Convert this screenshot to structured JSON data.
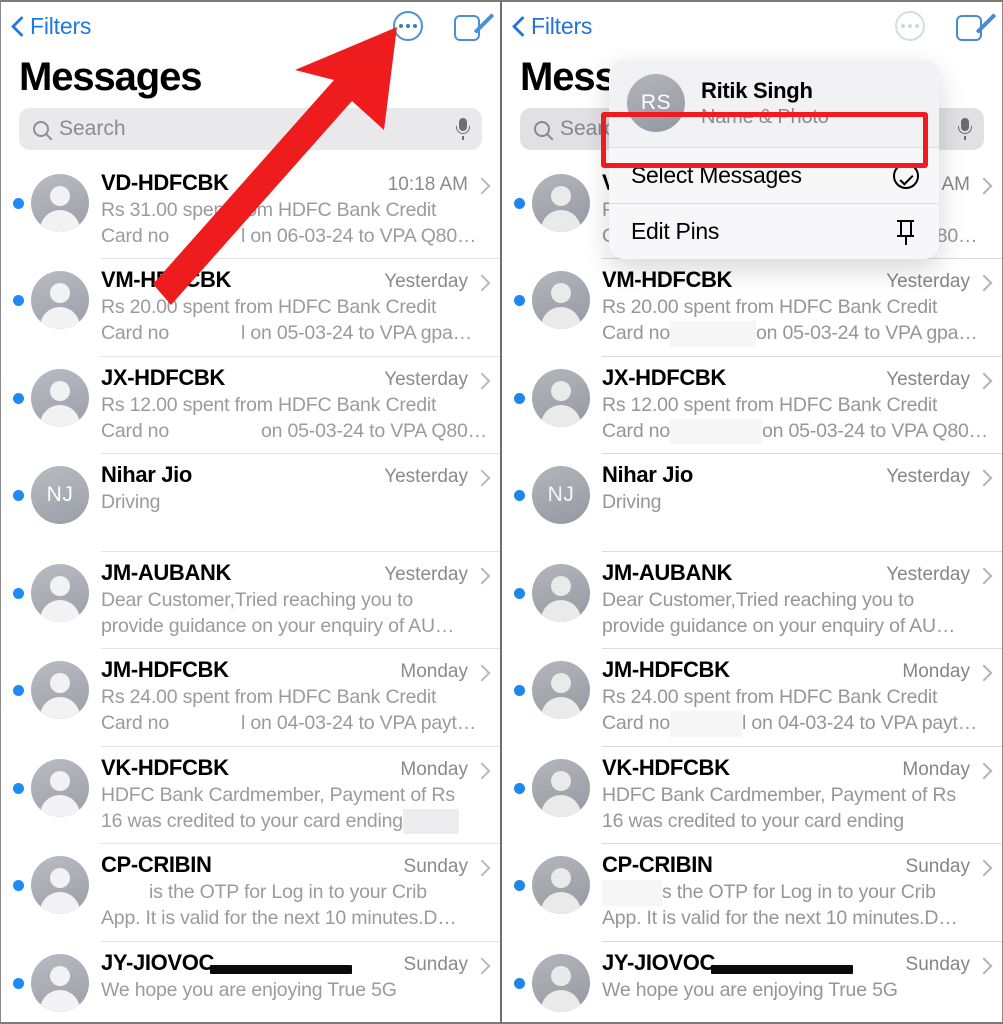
{
  "nav": {
    "back_label": "Filters",
    "more_icon": "ellipsis-circle-icon",
    "compose_icon": "compose-icon"
  },
  "header": {
    "title": "Messages"
  },
  "search": {
    "placeholder": "Search",
    "value": "",
    "mic_icon": "microphone-icon",
    "search_icon": "search-icon"
  },
  "popup": {
    "profile": {
      "initials": "RS",
      "name": "Ritik Singh",
      "subtitle": "Name & Photo"
    },
    "items": [
      {
        "label": "Select Messages",
        "icon": "check-circle-icon",
        "highlighted": true
      },
      {
        "label": "Edit Pins",
        "icon": "pin-icon",
        "highlighted": false
      }
    ]
  },
  "annotations": {
    "arrow_color": "#ee1c1c",
    "highlight_color": "#ef1b20"
  },
  "conversations": [
    {
      "title": "VD-HDFCBK",
      "time": "10:18 AM",
      "initials": "",
      "unread": true,
      "line1": "Rs 31.00 spent from HDFC Bank Credit",
      "line2_a": "Card no",
      "line2_b": "l on 06-03-24 to VPA Q80…"
    },
    {
      "title": "VM-HDFCBK",
      "time": "Yesterday",
      "initials": "",
      "unread": true,
      "line1": "Rs 20.00 spent from HDFC Bank Credit",
      "line2_a": "Card no",
      "line2_b": "l on 05-03-24 to VPA gpa…"
    },
    {
      "title": "JX-HDFCBK",
      "time": "Yesterday",
      "initials": "",
      "unread": true,
      "line1": "Rs 12.00 spent from HDFC Bank Credit",
      "line2_a": "Card no",
      "line2_b": "on 05-03-24 to VPA Q80…"
    },
    {
      "title": "Nihar Jio",
      "time": "Yesterday",
      "initials": "NJ",
      "unread": true,
      "line1": "Driving",
      "line2_a": "",
      "line2_b": ""
    },
    {
      "title": "JM-AUBANK",
      "time": "Yesterday",
      "initials": "",
      "unread": true,
      "line1": "Dear Customer,Tried reaching you to",
      "line2_a": "provide guidance on your enquiry of AU…",
      "line2_b": ""
    },
    {
      "title": "JM-HDFCBK",
      "time": "Monday",
      "initials": "",
      "unread": true,
      "line1": "Rs 24.00 spent from HDFC Bank Credit",
      "line2_a": "Card no",
      "line2_b": "l on 04-03-24 to VPA payt…"
    },
    {
      "title": "VK-HDFCBK",
      "time": "Monday",
      "initials": "",
      "unread": true,
      "line1": "HDFC Bank Cardmember, Payment of Rs",
      "line2_a": "16 was credited to your card ending",
      "line2_b": ""
    },
    {
      "title": "CP-CRIBIN",
      "time": "Sunday",
      "initials": "",
      "unread": true,
      "line1_a": "",
      "line1": "is the OTP for Log in to your Crib",
      "line2_a": "App. It is valid for the next 10 minutes.D…",
      "line2_b": ""
    },
    {
      "title": "JY-JIOVOC",
      "time": "Sunday",
      "initials": "",
      "unread": true,
      "line1": "We hope you are enjoying True 5G",
      "line2_a": "",
      "line2_b": ""
    }
  ]
}
